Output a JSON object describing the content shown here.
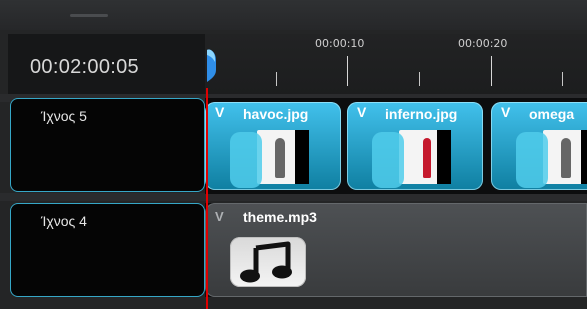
{
  "timeline": {
    "current_timecode": "00:02:00:05",
    "ruler_labels": [
      "00:00:10",
      "00:00:20"
    ]
  },
  "tracks": [
    {
      "name": "Ίχνος 5",
      "clips": [
        {
          "collapse_label": "V",
          "name": "havoc.jpg"
        },
        {
          "collapse_label": "V",
          "name": "inferno.jpg"
        },
        {
          "collapse_label": "V",
          "name": "omega"
        }
      ]
    },
    {
      "name": "Ίχνος 4",
      "audio_clip": {
        "collapse_label": "V",
        "name": "theme.mp3"
      }
    }
  ],
  "colors": {
    "accent": "#36a7c7",
    "playhead": "#e00000",
    "clip": "#2aa9d2"
  }
}
